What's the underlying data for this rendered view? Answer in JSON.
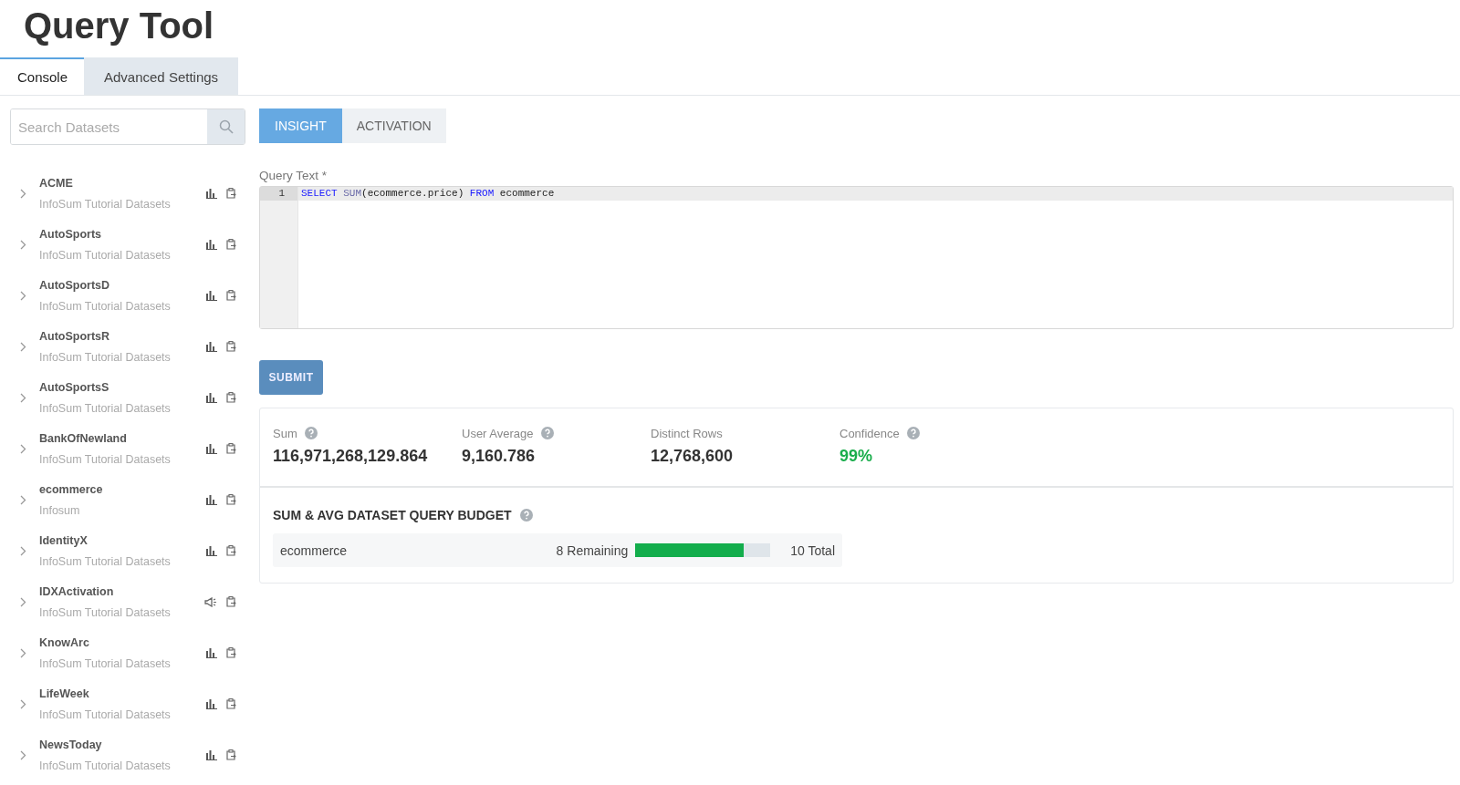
{
  "title": "Query Tool",
  "tabs": [
    {
      "label": "Console",
      "selected": true
    },
    {
      "label": "Advanced Settings",
      "selected": false
    }
  ],
  "sidebar": {
    "search": {
      "placeholder": "Search Datasets"
    },
    "items": [
      {
        "name": "ACME",
        "subtitle": "InfoSum Tutorial Datasets",
        "kind": "chart"
      },
      {
        "name": "AutoSports",
        "subtitle": "InfoSum Tutorial Datasets",
        "kind": "chart"
      },
      {
        "name": "AutoSportsD",
        "subtitle": "InfoSum Tutorial Datasets",
        "kind": "chart"
      },
      {
        "name": "AutoSportsR",
        "subtitle": "InfoSum Tutorial Datasets",
        "kind": "chart"
      },
      {
        "name": "AutoSportsS",
        "subtitle": "InfoSum Tutorial Datasets",
        "kind": "chart"
      },
      {
        "name": "BankOfNewland",
        "subtitle": "InfoSum Tutorial Datasets",
        "kind": "chart"
      },
      {
        "name": "ecommerce",
        "subtitle": "Infosum",
        "kind": "chart"
      },
      {
        "name": "IdentityX",
        "subtitle": "InfoSum Tutorial Datasets",
        "kind": "chart"
      },
      {
        "name": "IDXActivation",
        "subtitle": "InfoSum Tutorial Datasets",
        "kind": "megaphone"
      },
      {
        "name": "KnowArc",
        "subtitle": "InfoSum Tutorial Datasets",
        "kind": "chart"
      },
      {
        "name": "LifeWeek",
        "subtitle": "InfoSum Tutorial Datasets",
        "kind": "chart"
      },
      {
        "name": "NewsToday",
        "subtitle": "InfoSum Tutorial Datasets",
        "kind": "chart"
      }
    ]
  },
  "mode_tabs": [
    {
      "label": "INSIGHT",
      "selected": true
    },
    {
      "label": "ACTIVATION",
      "selected": false
    }
  ],
  "query": {
    "label": "Query Text *",
    "line_number": "1",
    "tokens": [
      {
        "text": "SELECT ",
        "kind": "keyword"
      },
      {
        "text": "SUM",
        "kind": "function"
      },
      {
        "text": "(ecommerce.price) ",
        "kind": "plain"
      },
      {
        "text": "FROM",
        "kind": "keyword"
      },
      {
        "text": " ecommerce",
        "kind": "plain"
      }
    ]
  },
  "submit": "SUBMIT",
  "stats": [
    {
      "label": "Sum",
      "help": true,
      "value": "116,971,268,129.864",
      "kind": "plain"
    },
    {
      "label": "User Average",
      "help": true,
      "value": "9,160.786",
      "kind": "plain"
    },
    {
      "label": "Distinct Rows",
      "help": false,
      "value": "12,768,600",
      "kind": "plain"
    },
    {
      "label": "Confidence",
      "help": true,
      "value": "99%",
      "kind": "good"
    }
  ],
  "budget": {
    "title": "SUM & AVG DATASET QUERY BUDGET",
    "help": true,
    "rows": [
      {
        "dataset": "ecommerce",
        "remaining": "8 Remaining",
        "level": 0.8,
        "total": "10 Total"
      }
    ]
  }
}
